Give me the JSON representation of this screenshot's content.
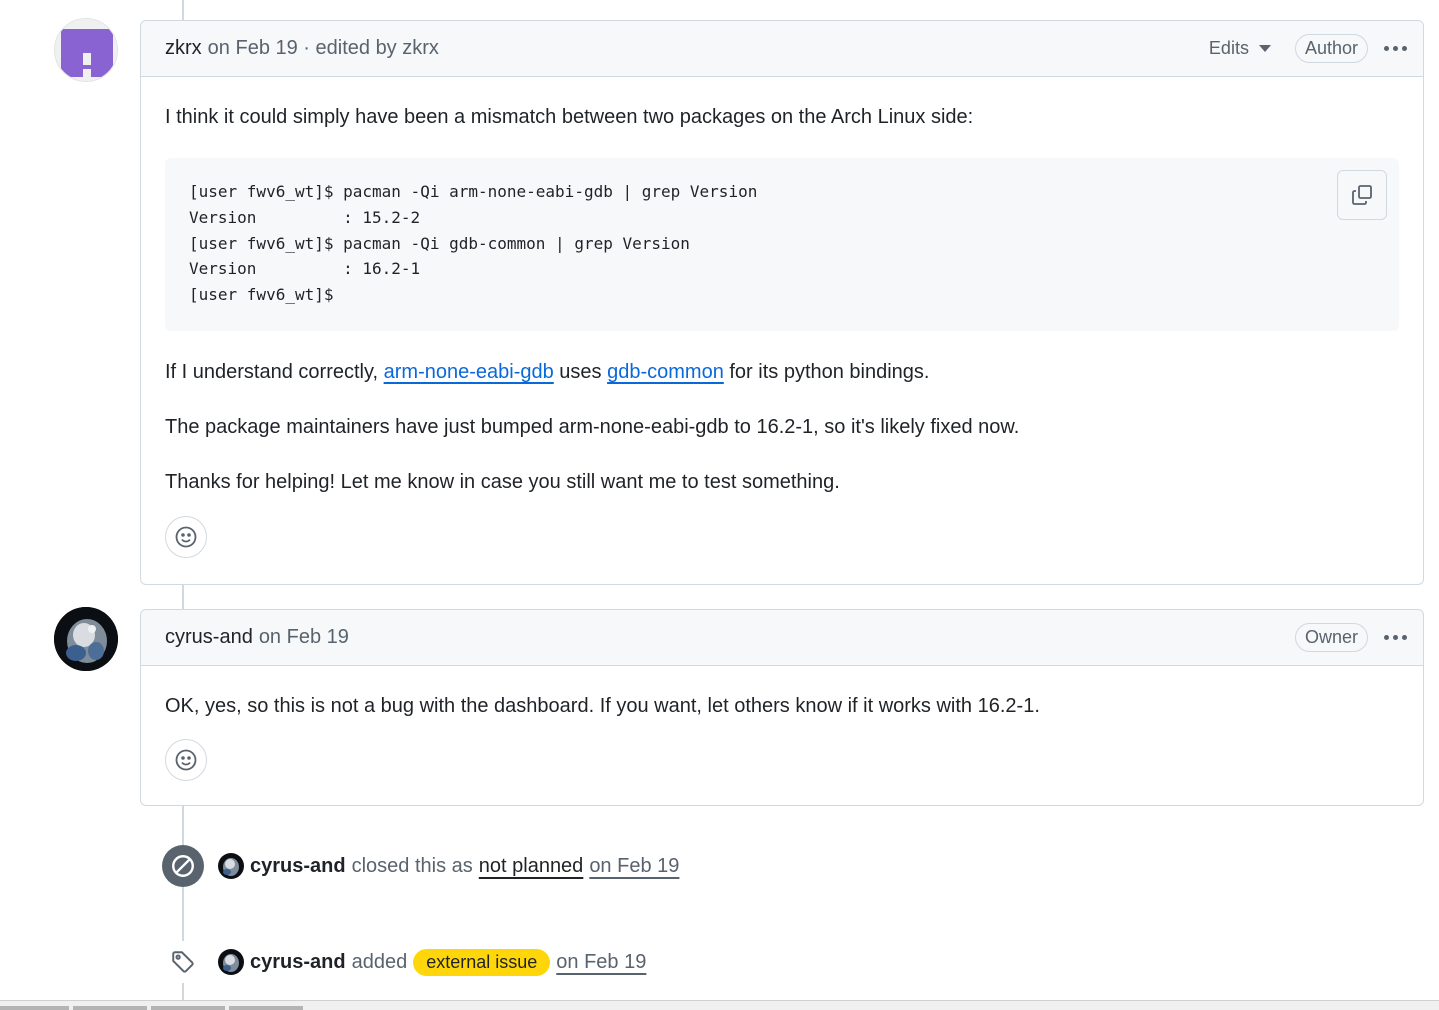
{
  "comments": [
    {
      "author": "zkrx",
      "meta": "on Feb 19 · edited by zkrx",
      "edits_label": "Edits",
      "role": "Author",
      "intro": "I think it could simply have been a mismatch between two packages on the Arch Linux side:",
      "code": "[user fwv6_wt]$ pacman -Qi arm-none-eabi-gdb | grep Version\nVersion         : 15.2-2\n[user fwv6_wt]$ pacman -Qi gdb-common | grep Version\nVersion         : 16.2-1\n[user fwv6_wt]$",
      "para2_pre": "If I understand correctly, ",
      "para2_link1": "arm-none-eabi-gdb",
      "para2_mid": " uses ",
      "para2_link2": "gdb-common",
      "para2_post": " for its python bindings.",
      "para3": "The package maintainers have just bumped arm-none-eabi-gdb to 16.2-1, so it's likely fixed now.",
      "para4": "Thanks for helping! Let me know in case you still want me to test something."
    },
    {
      "author": "cyrus-and",
      "meta": "on Feb 19",
      "role": "Owner",
      "body": "OK, yes, so this is not a bug with the dashboard. If you want, let others know if it works with 16.2-1."
    }
  ],
  "events": [
    {
      "actor": "cyrus-and",
      "action": "closed this as",
      "reason": "not planned",
      "date": "on Feb 19",
      "icon": "skip-icon"
    },
    {
      "actor": "cyrus-and",
      "action": "added",
      "label": "external issue",
      "date": "on Feb 19",
      "icon": "tag-icon"
    }
  ],
  "colors": {
    "link": "#0969da",
    "label_bg": "#ffd60a",
    "closed_icon_bg": "#59636e",
    "identicon": "#8a63d2"
  }
}
